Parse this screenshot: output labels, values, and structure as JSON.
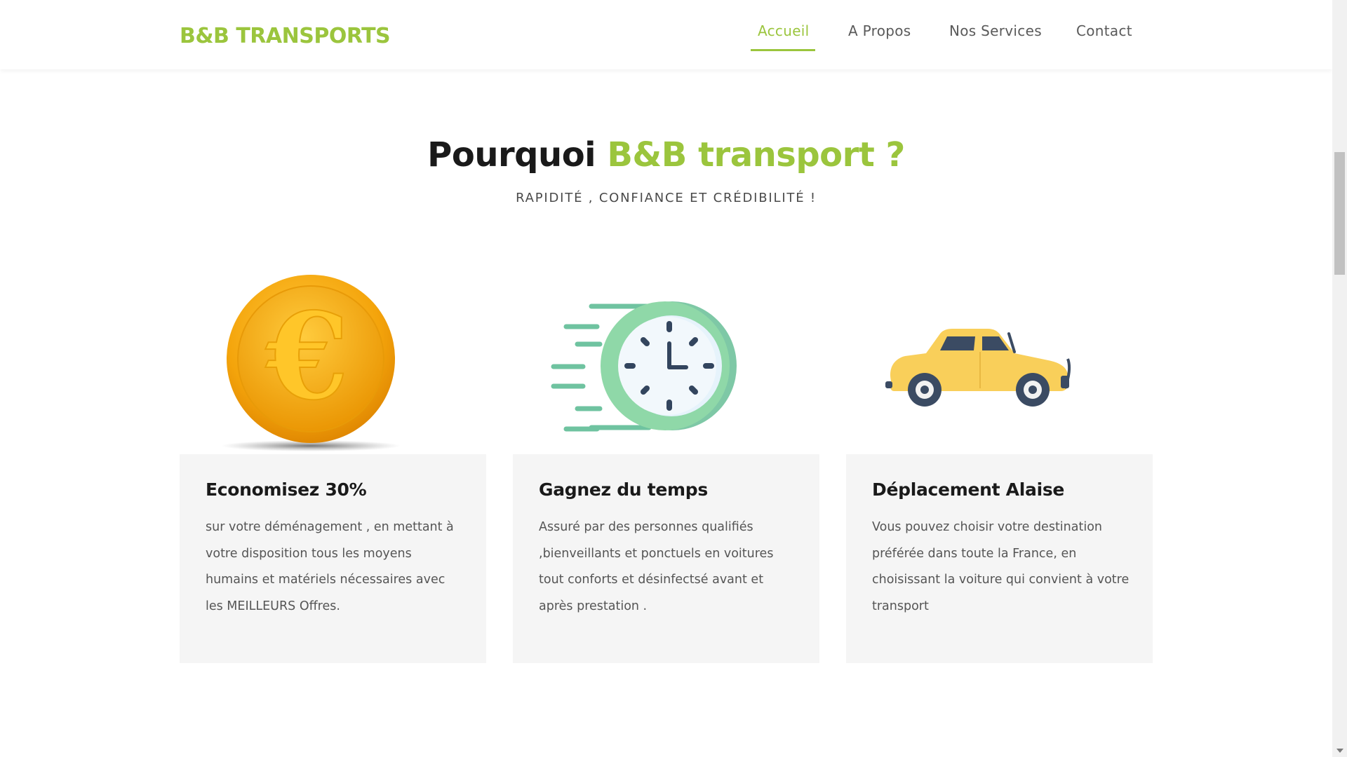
{
  "header": {
    "logo": "B&B TRANSPORTS",
    "nav": [
      {
        "label": "Accueil",
        "active": true
      },
      {
        "label": "A Propos",
        "active": false
      },
      {
        "label": "Nos Services",
        "active": false
      },
      {
        "label": "Contact",
        "active": false
      }
    ]
  },
  "section": {
    "title_prefix": "Pourquoi ",
    "title_accent": "B&B transport ?",
    "subtitle": "RAPIDITÉ , CONFIANCE ET CRÉDIBILITÉ !"
  },
  "features": [
    {
      "icon": "euro-coin-icon",
      "title": "Economisez 30%",
      "text": "sur votre déménagement , en mettant à votre disposition tous les moyens humains et matériels nécessaires avec les MEILLEURS Offres."
    },
    {
      "icon": "fast-clock-icon",
      "title": "Gagnez du temps",
      "text": "Assuré par des personnes qualifiés ,bienveillants et ponctuels en voitures tout conforts et désinfectsé avant et après prestation ."
    },
    {
      "icon": "car-icon",
      "title": "Déplacement Alaise",
      "text": "Vous pouvez choisir votre destination préférée dans toute la France, en choisissant la voiture qui convient à votre transport"
    }
  ],
  "colors": {
    "accent": "#9bc53d",
    "card_bg": "#f5f5f5",
    "text_dark": "#1a1a1a"
  }
}
